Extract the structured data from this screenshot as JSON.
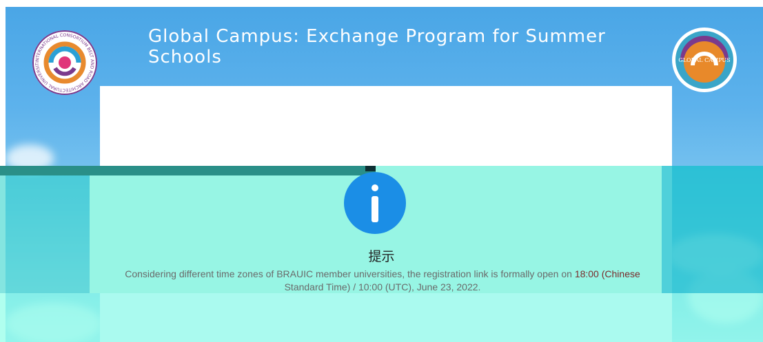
{
  "header": {
    "title": "Global Campus: Exchange Program for Summer Schools"
  },
  "logos": {
    "left": {
      "text": "INTERNATIONAL CONSORTIUM BELT AND ROAD ARCHITECTURAL UNIVERSITY"
    },
    "right": {
      "text": "GLOBAL CAMPUS"
    }
  },
  "dialog": {
    "icon": "info-icon",
    "title": "提示",
    "message_part1": "Considering different time zones of BRAUIC member universities, the registration link is formally open on ",
    "message_highlight": "18:00 (Chinese",
    "message_part2": "Standard Time) / 10:00 (UTC), June 23, 2022."
  },
  "colors": {
    "sky": "#5db2ec",
    "dialog_bg": "#97f5e4",
    "info_icon": "#1b8ee6",
    "highlight": "#7a2a2a"
  }
}
